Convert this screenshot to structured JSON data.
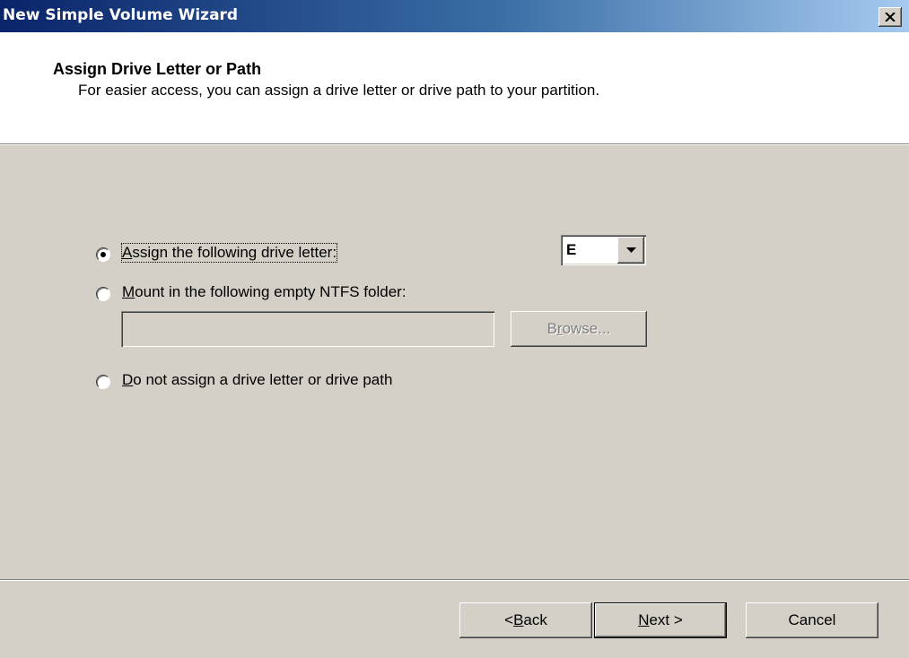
{
  "window": {
    "title": "New Simple Volume Wizard"
  },
  "header": {
    "title": "Assign Drive Letter or Path",
    "subtitle": "For easier access, you can assign a drive letter or drive path to your partition."
  },
  "options": {
    "assign_letter": {
      "access_key": "A",
      "rest": "ssign the following drive letter:",
      "checked": true
    },
    "mount_folder": {
      "access_key": "M",
      "rest": "ount in the following empty NTFS folder:",
      "checked": false
    },
    "no_assign": {
      "access_key": "D",
      "rest": "o not assign a drive letter or drive path",
      "checked": false
    }
  },
  "drive_letter": {
    "value": "E"
  },
  "folder_path": {
    "value": ""
  },
  "browse": {
    "pre": "B",
    "access_key": "r",
    "post": "owse..."
  },
  "footer": {
    "back": {
      "pre": "< ",
      "access_key": "B",
      "post": "ack"
    },
    "next": {
      "access_key": "N",
      "post": "ext >"
    },
    "cancel": "Cancel"
  },
  "icons": {
    "close": "close-icon",
    "dropdown": "chevron-down-icon"
  }
}
